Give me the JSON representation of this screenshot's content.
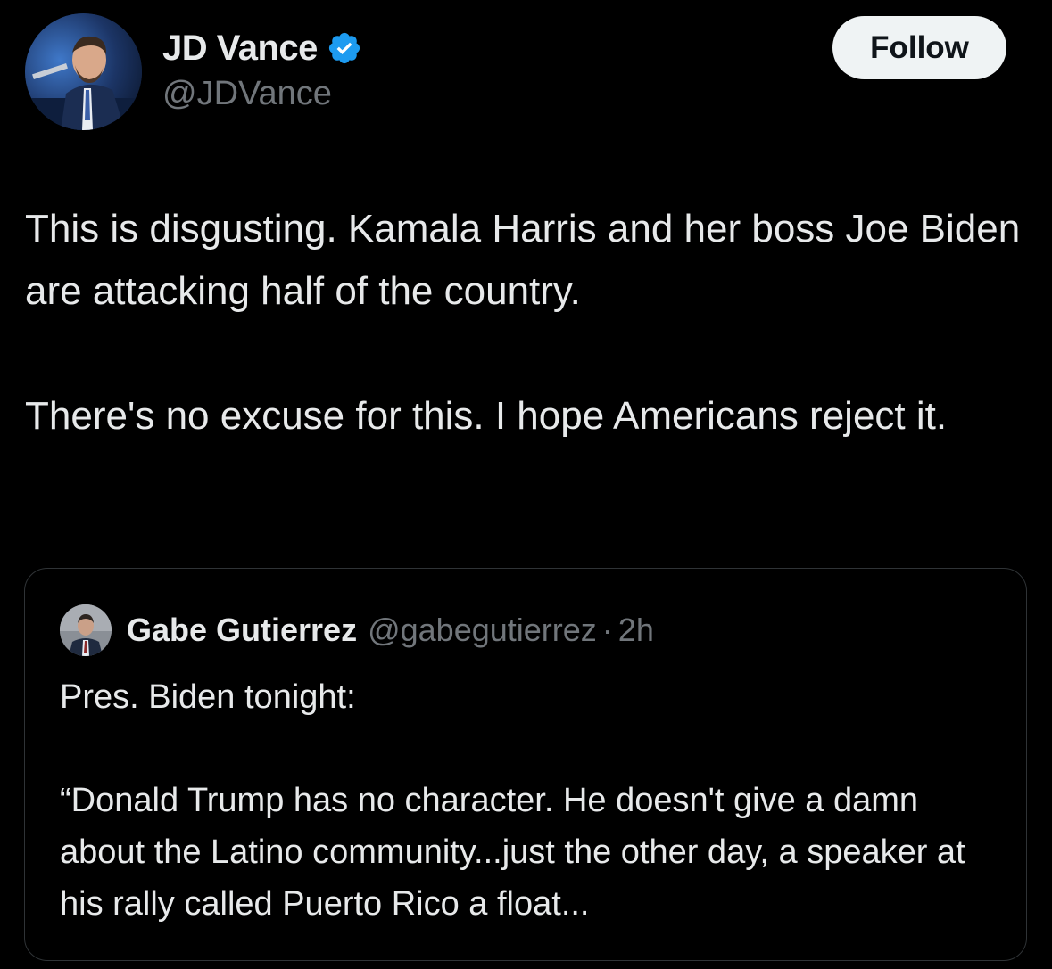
{
  "author": {
    "display_name": "JD Vance",
    "handle": "@JDVance",
    "verified": true,
    "avatar_icon": "profile-photo"
  },
  "follow_label": "Follow",
  "tweet": {
    "paragraph_1": "This is disgusting. Kamala Harris and her boss Joe Biden are attacking half of the country.",
    "paragraph_2": "There's no excuse for this. I hope Americans reject it."
  },
  "quote": {
    "display_name": "Gabe Gutierrez",
    "handle": "@gabegutierrez",
    "separator": "·",
    "time": "2h",
    "paragraph_1": "Pres. Biden tonight:",
    "paragraph_2": "“Donald Trump has no character. He doesn't give a damn about the Latino community...just the other day, a speaker at his rally called Puerto Rico a float..."
  },
  "colors": {
    "background": "#000000",
    "text_primary": "#e7e9ea",
    "text_secondary": "#71767b",
    "verified_badge": "#1d9bf0",
    "follow_button_bg": "#eff3f4",
    "card_border": "#2f3336"
  }
}
